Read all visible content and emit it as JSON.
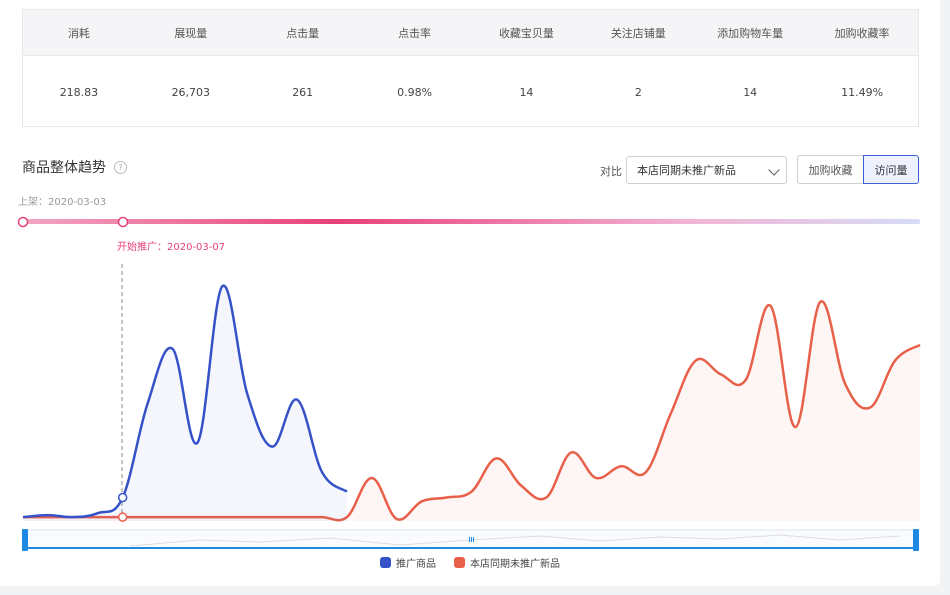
{
  "metrics": {
    "headers": [
      "消耗",
      "展现量",
      "点击量",
      "点击率",
      "收藏宝贝量",
      "关注店铺量",
      "添加购物车量",
      "加购收藏率"
    ],
    "values": [
      "218.83",
      "26,703",
      "261",
      "0.98%",
      "14",
      "2",
      "14",
      "11.49%"
    ]
  },
  "trend": {
    "title": "商品整体趋势",
    "help_icon": "question-circle-icon",
    "compare_label": "对比",
    "compare_select": "本店同期未推广新品",
    "toggle": [
      "加购收藏",
      "访问量"
    ],
    "toggle_active": 1,
    "listing_label": "上架：2020-03-03",
    "promo_label": "开始推广：2020-03-07"
  },
  "colors": {
    "promoted": "#3652c8",
    "baseline": "#e8604a",
    "accent_pink": "#e8407a"
  },
  "chart_data": {
    "type": "area",
    "series": [
      {
        "name": "推广商品",
        "values": [
          2,
          3,
          2,
          4,
          12,
          60,
          88,
          40,
          120,
          65,
          38,
          62,
          25,
          15,
          null,
          null,
          null,
          null,
          null,
          null,
          null,
          null,
          null,
          null,
          null,
          null,
          null,
          null,
          null,
          null,
          null,
          null,
          null,
          null,
          null,
          null,
          null
        ]
      },
      {
        "name": "本店同期未推广新品",
        "values": [
          2,
          2,
          2,
          2,
          2,
          2,
          2,
          2,
          2,
          2,
          2,
          2,
          2,
          2,
          22,
          1,
          10,
          12,
          15,
          32,
          18,
          12,
          35,
          22,
          28,
          25,
          55,
          82,
          75,
          72,
          110,
          48,
          112,
          70,
          58,
          82,
          90
        ]
      }
    ],
    "legend": [
      "推广商品",
      "本店同期未推广新品"
    ],
    "legend_position": "bottom"
  }
}
